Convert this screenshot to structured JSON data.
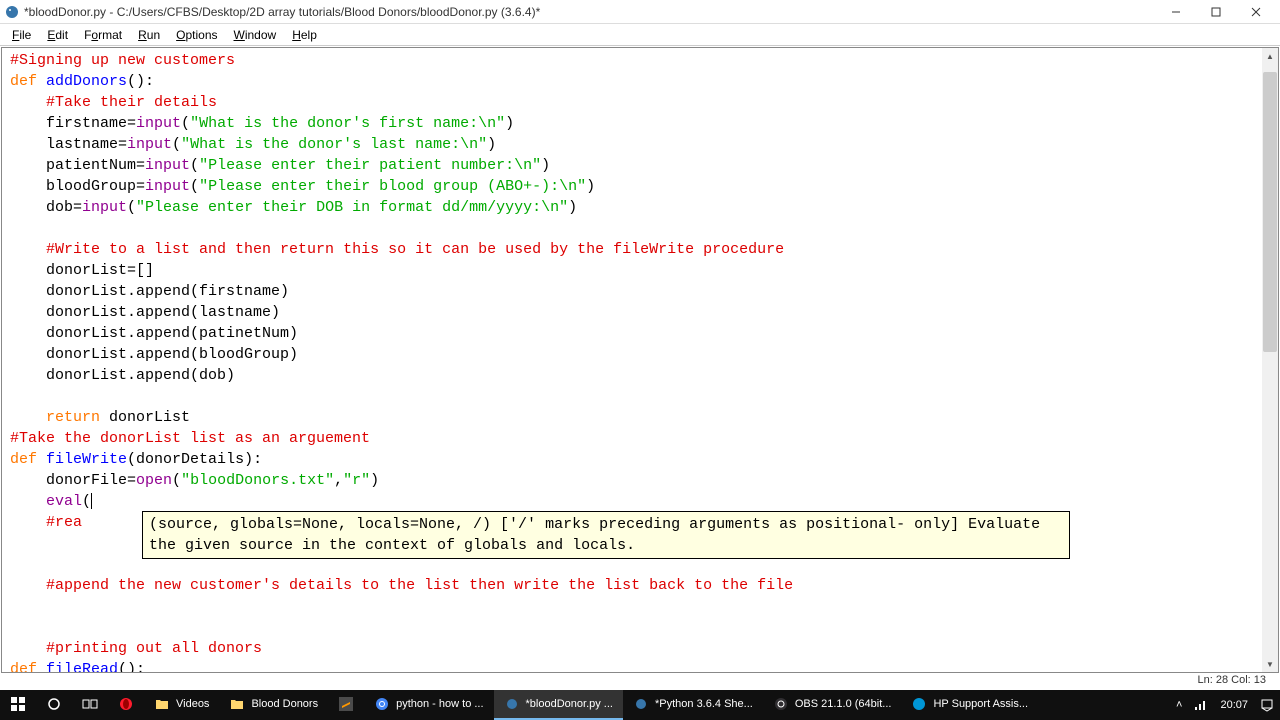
{
  "window": {
    "title": "*bloodDonor.py - C:/Users/CFBS/Desktop/2D array tutorials/Blood Donors/bloodDonor.py (3.6.4)*"
  },
  "menu": {
    "file": "File",
    "edit": "Edit",
    "format": "Format",
    "run": "Run",
    "options": "Options",
    "window": "Window",
    "help": "Help"
  },
  "code": {
    "c1": "#Signing up new customers",
    "kw_def1": "def",
    "fn_add": "addDonors",
    "paren_colon": "():",
    "c2": "#Take their details",
    "l3a": "    firstname=",
    "bi_input": "input",
    "s3": "\"What is the donor's first name:\\n\"",
    "l4a": "    lastname=",
    "s4": "\"What is the donor's last name:\\n\"",
    "l5a": "    patientNum=",
    "s5": "\"Please enter their patient number:\\n\"",
    "l6a": "    bloodGroup=",
    "s6": "\"Please enter their blood group (ABO+-):\\n\"",
    "l7a": "    dob=",
    "s7": "\"Please enter their DOB in format dd/mm/yyyy:\\n\"",
    "c8": "#Write to a list and then return this so it can be used by the fileWrite procedure",
    "l9": "    donorList=[]",
    "l10": "    donorList.append(firstname)",
    "l11": "    donorList.append(lastname)",
    "l12": "    donorList.append(patinetNum)",
    "l13": "    donorList.append(bloodGroup)",
    "l14": "    donorList.append(dob)",
    "kw_return": "return",
    "l15b": " donorList",
    "c16": "#Take the donorList list as an arguement",
    "kw_def2": "def",
    "fn_fw": "fileWrite",
    "fw_args": "(donorDetails):",
    "l18a": "    donorFile=",
    "bi_open": "open",
    "s18": "\"bloodDonors.txt\"",
    "s18b": "\"r\"",
    "l19a": "    ",
    "bi_eval": "eval",
    "l19b": "(",
    "c20a": "#rea",
    "c21": "#append the new customer's details to the list then write the list back to the file",
    "c22": "#printing out all donors",
    "kw_def3": "def",
    "fn_fr": "fileRead",
    "fr_args": "():"
  },
  "calltip": {
    "line1": "(source, globals=None, locals=None, /) ['/' marks preceding arguments as positional-",
    "line2": "     only]",
    "line3": "Evaluate the given source in the context of globals and locals."
  },
  "status": {
    "position": "Ln: 28  Col: 13"
  },
  "taskbar": {
    "videos": "Videos",
    "blooddonors": "Blood Donors",
    "chrome": "python - how to ...",
    "idle1": "*bloodDonor.py ...",
    "idle2": "*Python 3.6.4 She...",
    "obs": "OBS 21.1.0 (64bit...",
    "hp": "HP Support Assis...",
    "time": "20:07"
  }
}
